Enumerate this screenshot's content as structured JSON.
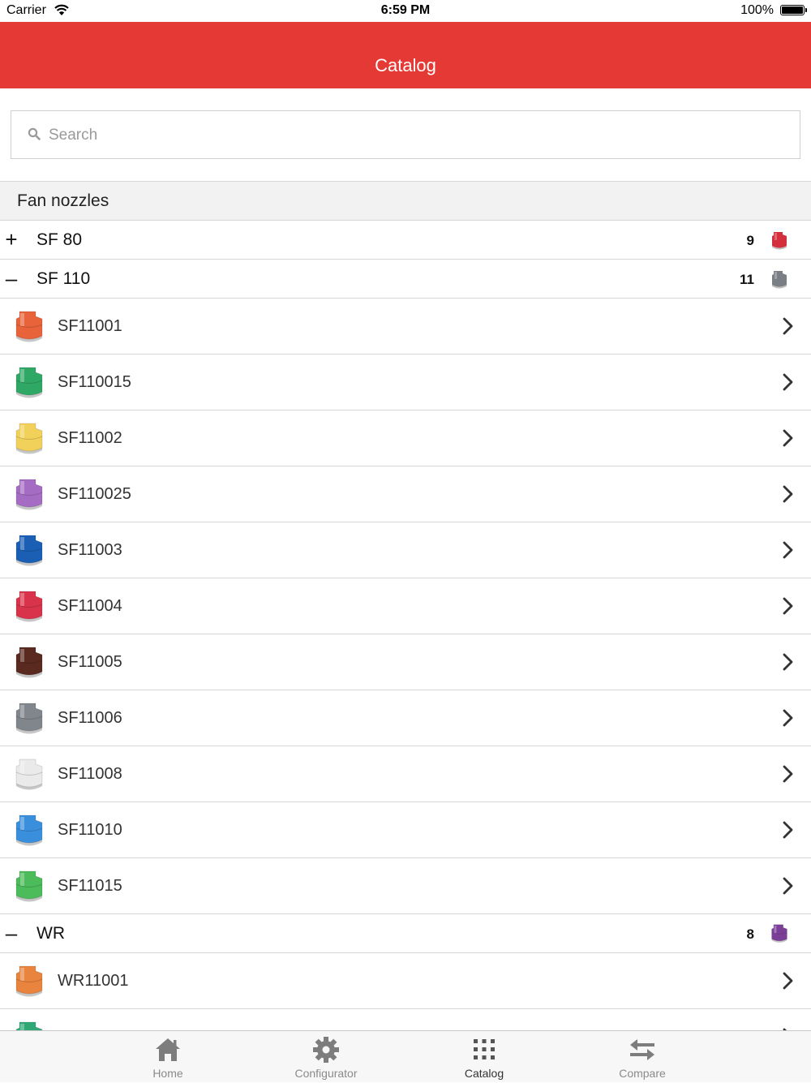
{
  "status_bar": {
    "carrier": "Carrier",
    "time": "6:59 PM",
    "battery": "100%"
  },
  "nav": {
    "title": "Catalog"
  },
  "search": {
    "placeholder": "Search"
  },
  "section": {
    "title": "Fan nozzles"
  },
  "groups": [
    {
      "toggle": "+",
      "name": "SF 80",
      "count": "9",
      "icon_color": "#d32f3c"
    },
    {
      "toggle": "–",
      "name": "SF 110",
      "count": "11",
      "icon_color": "#7a7f85"
    },
    {
      "toggle": "–",
      "name": "WR",
      "count": "8",
      "icon_color": "#7b3f98"
    }
  ],
  "items": [
    {
      "label": "SF11001",
      "color": "#e8623a"
    },
    {
      "label": "SF110015",
      "color": "#2fa866"
    },
    {
      "label": "SF11002",
      "color": "#f2d15a"
    },
    {
      "label": "SF110025",
      "color": "#a56cc4"
    },
    {
      "label": "SF11003",
      "color": "#1a5fb4"
    },
    {
      "label": "SF11004",
      "color": "#d8334a"
    },
    {
      "label": "SF11005",
      "color": "#5a2a20"
    },
    {
      "label": "SF11006",
      "color": "#80868c"
    },
    {
      "label": "SF11008",
      "color": "#eaeaea"
    },
    {
      "label": "SF11010",
      "color": "#3a8fdd"
    },
    {
      "label": "SF11015",
      "color": "#4cbb5a"
    },
    {
      "label": "WR11001",
      "color": "#e8843e"
    },
    {
      "label": "",
      "color": "#2fa876"
    }
  ],
  "tabs": [
    {
      "label": "Home",
      "icon": "home-icon"
    },
    {
      "label": "Configurator",
      "icon": "gear-icon"
    },
    {
      "label": "Catalog",
      "icon": "grid-icon"
    },
    {
      "label": "Compare",
      "icon": "swap-arrows-icon"
    }
  ]
}
